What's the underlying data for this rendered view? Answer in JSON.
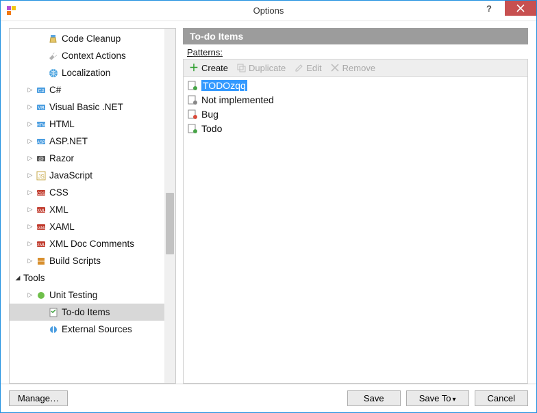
{
  "window": {
    "title": "Options"
  },
  "tree": {
    "items": [
      {
        "indent": 2,
        "icon": "cleanup",
        "label": "Code Cleanup"
      },
      {
        "indent": 2,
        "icon": "wrench",
        "label": "Context Actions"
      },
      {
        "indent": 2,
        "icon": "globe",
        "label": "Localization"
      },
      {
        "indent": 1,
        "exp": "collapsed",
        "icon": "csharp",
        "label": "C#"
      },
      {
        "indent": 1,
        "exp": "collapsed",
        "icon": "vb",
        "label": "Visual Basic .NET"
      },
      {
        "indent": 1,
        "exp": "collapsed",
        "icon": "html",
        "label": "HTML"
      },
      {
        "indent": 1,
        "exp": "collapsed",
        "icon": "asp",
        "label": "ASP.NET"
      },
      {
        "indent": 1,
        "exp": "collapsed",
        "icon": "razor",
        "label": "Razor"
      },
      {
        "indent": 1,
        "exp": "collapsed",
        "icon": "js",
        "label": "JavaScript"
      },
      {
        "indent": 1,
        "exp": "collapsed",
        "icon": "css",
        "label": "CSS"
      },
      {
        "indent": 1,
        "exp": "collapsed",
        "icon": "xml",
        "label": "XML"
      },
      {
        "indent": 1,
        "exp": "collapsed",
        "icon": "xaml",
        "label": "XAML"
      },
      {
        "indent": 1,
        "exp": "collapsed",
        "icon": "xmldoc",
        "label": "XML Doc Comments"
      },
      {
        "indent": 1,
        "exp": "collapsed",
        "icon": "build",
        "label": "Build Scripts"
      },
      {
        "indent": 0,
        "exp": "expanded",
        "icon": "none",
        "label": "Tools",
        "bold": false
      },
      {
        "indent": 1,
        "exp": "collapsed",
        "icon": "test",
        "label": "Unit Testing"
      },
      {
        "indent": 2,
        "icon": "todo",
        "label": "To-do Items",
        "selected": true
      },
      {
        "indent": 2,
        "icon": "ext",
        "label": "External Sources"
      }
    ]
  },
  "rightPane": {
    "header": "To-do Items",
    "sectionLabel": "Patterns:",
    "toolbar": {
      "create": "Create",
      "duplicate": "Duplicate",
      "edit": "Edit",
      "remove": "Remove"
    },
    "patterns": [
      {
        "icon": "pat-green",
        "label": "TODOzqq",
        "selected": true
      },
      {
        "icon": "pat-gear",
        "label": "Not implemented"
      },
      {
        "icon": "pat-red",
        "label": "Bug"
      },
      {
        "icon": "pat-green",
        "label": "Todo"
      }
    ]
  },
  "buttons": {
    "manage": "Manage…",
    "save": "Save",
    "saveTo": "Save To",
    "cancel": "Cancel"
  }
}
